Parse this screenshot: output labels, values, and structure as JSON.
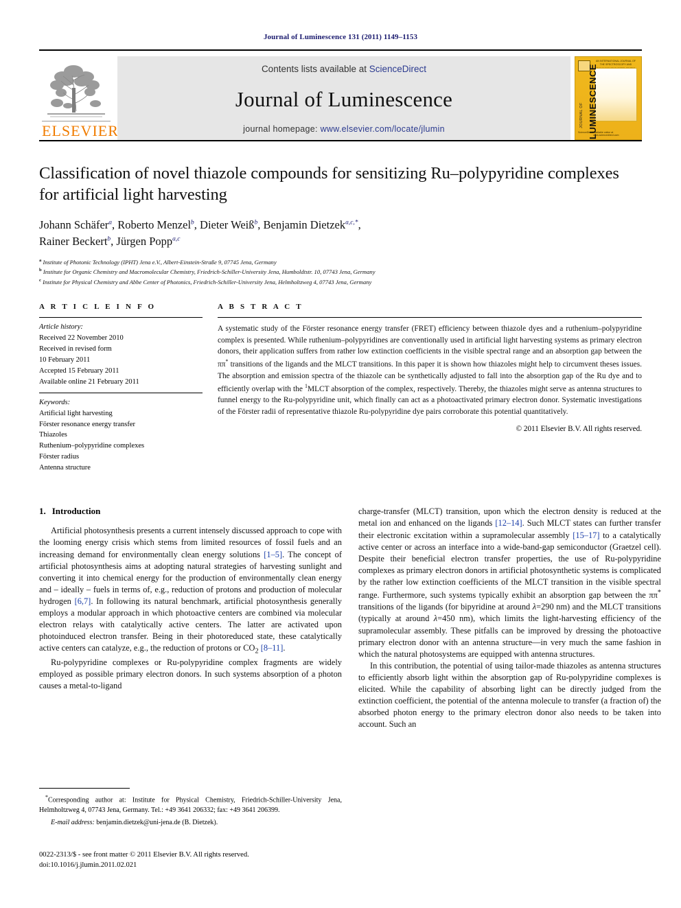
{
  "running_head": "Journal of Luminescence 131 (2011) 1149–1153",
  "masthead": {
    "contents_prefix": "Contents lists available at ",
    "sciencedirect": "ScienceDirect",
    "journal_title": "Journal of Luminescence",
    "homepage_prefix": "journal homepage: ",
    "homepage_url": "www.elsevier.com/locate/jlumin",
    "publisher_logo_text": "ELSEVIER",
    "cover": {
      "vertical_main": "LUMINESCENCE",
      "vertical_sub": "JOURNAL OF",
      "top_note": "AN INTERNATIONAL JOURNAL OF THE SPECTROSCOPY AND DYNAMICS OF EXCITED STATES",
      "bottom_left": "ScienceDirect",
      "bottom_right": "Available online at www.sciencedirect.com"
    },
    "accent_orange": "#f07c00",
    "cover_yellow": "#f0b81c",
    "link_blue": "#2b3a8f"
  },
  "article": {
    "title": "Classification of novel thiazole compounds for sensitizing Ru–polypyridine complexes for artificial light harvesting",
    "authors": [
      {
        "name": "Johann Schäfer",
        "sup": "a"
      },
      {
        "name": "Roberto Menzel",
        "sup": "b"
      },
      {
        "name": "Dieter Weiß",
        "sup": "b"
      },
      {
        "name": "Benjamin Dietzek",
        "sup": "a,c,*"
      },
      {
        "name": "Rainer Beckert",
        "sup": "b"
      },
      {
        "name": "Jürgen Popp",
        "sup": "a,c"
      }
    ],
    "affiliations": [
      {
        "mark": "a",
        "text": "Institute of Photonic Technology (IPHT) Jena e.V., Albert-Einstein-Straße 9, 07745 Jena, Germany"
      },
      {
        "mark": "b",
        "text": "Institute for Organic Chemistry and Macromolecular Chemistry, Friedrich-Schiller-University Jena, Humboldtstr. 10, 07743 Jena, Germany"
      },
      {
        "mark": "c",
        "text": "Institute for Physical Chemistry and Abbe Center of Photonics, Friedrich-Schiller-University Jena, Helmholtzweg 4, 07743 Jena, Germany"
      }
    ]
  },
  "article_info": {
    "heading": "A R T I C L E   I N F O",
    "history_label": "Article history:",
    "history": [
      "Received 22 November 2010",
      "Received in revised form",
      "10 February 2011",
      "Accepted 15 February 2011",
      "Available online 21 February 2011"
    ],
    "keywords_label": "Keywords:",
    "keywords": [
      "Artificial light harvesting",
      "Förster resonance energy transfer",
      "Thiazoles",
      "Ruthenium–polypyridine complexes",
      "Förster radius",
      "Antenna structure"
    ]
  },
  "abstract": {
    "heading": "A B S T R A C T",
    "text_part1": "A systematic study of the Förster resonance energy transfer (FRET) efficiency between thiazole dyes and a ruthenium–polypyridine complex is presented. While ruthenium–polypyridines are conventionally used in artificial light harvesting systems as primary electron donors, their application suffers from rather low extinction coefficients in the visible spectral range and an absorption gap between the ππ",
    "sup1": "*",
    "text_part2": " transitions of the ligands and the MLCT transitions. In this paper it is shown how thiazoles might help to circumvent theses issues. The absorption and emission spectra of the thiazole can be synthetically adjusted to fall into the absorption gap of the Ru dye and to efficiently overlap with the ",
    "sup2": "1",
    "text_part3": "MLCT absorption of the complex, respectively. Thereby, the thiazoles might serve as antenna structures to funnel energy to the Ru-polypyridine unit, which finally can act as a photoactivated primary electron donor. Systematic investigations of the Förster radii of representative thiazole Ru-polypyridine dye pairs corroborate this potential quantitatively.",
    "copyright": "© 2011 Elsevier B.V. All rights reserved."
  },
  "introduction": {
    "number": "1.",
    "heading": "Introduction",
    "left_p1_a": "Artificial photosynthesis presents a current intensely discussed approach to cope with the looming energy crisis which stems from limited resources of fossil fuels and an increasing demand for environmentally clean energy solutions ",
    "left_p1_ref1": "[1–5]",
    "left_p1_b": ". The concept of artificial photosynthesis aims at adopting natural strategies of harvesting sunlight and converting it into chemical energy for the production of environmentally clean energy and – ideally – fuels in terms of, e.g., reduction of protons and production of molecular hydrogen ",
    "left_p1_ref2": "[6,7]",
    "left_p1_c": ". In following its natural benchmark, artificial photosynthesis generally employs a modular approach in which photoactive centers are combined via molecular electron relays with catalytically active centers. The latter are activated upon photoinduced electron transfer. Being in their photoreduced state, these catalytically active centers can catalyze, e.g., the reduction of protons or CO",
    "left_p1_sub": "2",
    "left_p1_d": " ",
    "left_p1_ref3": "[8–11]",
    "left_p1_e": ".",
    "left_p2": "Ru-polypyridine complexes or Ru-polypyridine complex fragments are widely employed as possible primary electron donors. In such systems absorption of a photon causes a metal-to-ligand",
    "right_p1_a": "charge-transfer (MLCT) transition, upon which the electron density is reduced at the metal ion and enhanced on the ligands ",
    "right_p1_ref1": "[12–14]",
    "right_p1_b": ". Such MLCT states can further transfer their electronic excitation within a supramolecular assembly ",
    "right_p1_ref2": "[15–17]",
    "right_p1_c": " to a catalytically active center or across an interface into a wide-band-gap semiconductor (Graetzel cell). Despite their beneficial electron transfer properties, the use of Ru-polypyridine complexes as primary electron donors in artificial photosynthetic systems is complicated by the rather low extinction coefficients of the MLCT transition in the visible spectral range. Furthermore, such systems typically exhibit an absorption gap between the ππ",
    "right_p1_sup": "*",
    "right_p1_d": " transitions of the ligands (for bipyridine at around ",
    "right_p1_lambda1": "λ",
    "right_p1_e": "=290 nm) and the MLCT transitions (typically at around ",
    "right_p1_lambda2": "λ",
    "right_p1_f": "=450 nm), which limits the light-harvesting efficiency of the supramolecular assembly. These pitfalls can be improved by dressing the photoactive primary electron donor with an antenna structure—in very much the same fashion in which the natural photosystems are equipped with antenna structures.",
    "right_p2": "In this contribution, the potential of using tailor-made thiazoles as antenna structures to efficiently absorb light within the absorption gap of Ru-polypyridine complexes is elicited. While the capability of absorbing light can be directly judged from the extinction coefficient, the potential of the antenna molecule to transfer (a fraction of) the absorbed photon energy to the primary electron donor also needs to be taken into account. Such an"
  },
  "footnotes": {
    "corresponding_mark": "*",
    "corresponding": "Corresponding author at: Institute for Physical Chemistry, Friedrich-Schiller-University Jena, Helmholtzweg 4, 07743 Jena, Germany. Tel.: +49 3641 206332; fax: +49 3641 206399.",
    "email_label": "E-mail address:",
    "email_value": "benjamin.dietzek@uni-jena.de (B. Dietzek)."
  },
  "imprint": {
    "line1": "0022-2313/$ - see front matter © 2011 Elsevier B.V. All rights reserved.",
    "line2": "doi:10.1016/j.jlumin.2011.02.021"
  }
}
